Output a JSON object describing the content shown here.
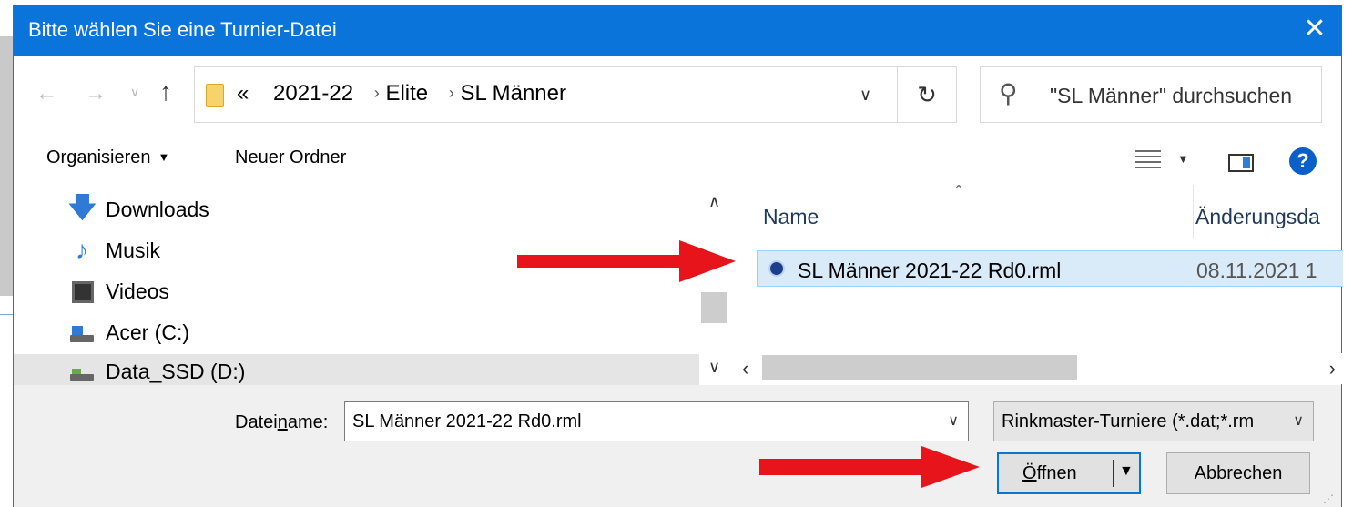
{
  "dialog": {
    "title": "Bitte wählen Sie eine Turnier-Datei",
    "close_glyph": "✕"
  },
  "address": {
    "overflow": "«",
    "crumbs": [
      "2021-22",
      "Elite",
      "SL Männer"
    ],
    "separator": "›"
  },
  "search": {
    "placeholder": "\"SL Männer\" durchsuchen"
  },
  "toolbar": {
    "organize": "Organisieren",
    "new_folder": "Neuer Ordner",
    "help_glyph": "?"
  },
  "navpane": {
    "items": [
      {
        "label": "Downloads",
        "icon": "download-icon"
      },
      {
        "label": "Musik",
        "icon": "music-icon"
      },
      {
        "label": "Videos",
        "icon": "video-icon"
      },
      {
        "label": "Acer (C:)",
        "icon": "windows-drive-icon"
      },
      {
        "label": "Data_SSD (D:)",
        "icon": "ssd-drive-icon",
        "selected": true
      }
    ]
  },
  "filelist": {
    "columns": [
      "Name",
      "Änderungsda"
    ],
    "files": [
      {
        "name": "SL Männer 2021-22 Rd0.rml",
        "modified": "08.11.2021 1",
        "selected": true
      }
    ]
  },
  "bottom": {
    "filename_label_pre": "Datei",
    "filename_label_accel": "n",
    "filename_label_post": "ame:",
    "filename_value": "SL Männer 2021-22 Rd0.rml",
    "filter_value": "Rinkmaster-Turniere (*.dat;*.rm",
    "open_label_accel": "Ö",
    "open_label_rest": "ffnen",
    "cancel_label": "Abbrechen"
  },
  "colors": {
    "titlebar": "#0a74da",
    "selection": "#d9ebf9",
    "annotation_arrow": "#e8141b"
  }
}
